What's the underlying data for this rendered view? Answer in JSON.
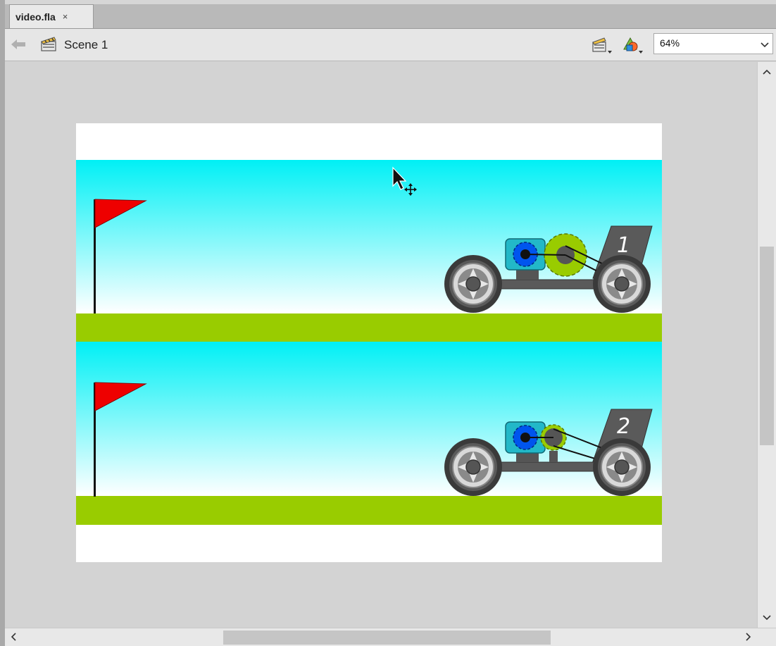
{
  "document": {
    "tab_title": "video.fla",
    "close_glyph": "×"
  },
  "editbar": {
    "scene_label": "Scene 1",
    "zoom_value": "64%",
    "icons": [
      "back-arrow-icon",
      "scene-clapper-icon",
      "edit-symbols-icon",
      "edit-objects-icon",
      "chevron-down-icon"
    ]
  },
  "stage": {
    "cars": [
      {
        "number": "1"
      },
      {
        "number": "2"
      }
    ]
  },
  "colors": {
    "sky_top": "#00f0f5",
    "sky_bottom": "#ffffff",
    "grass": "#99cc00",
    "flag": "#ee0000",
    "gear_large_lime": "#99cc00",
    "gear_blue": "#0055ee",
    "motor_teal": "#22b8c8",
    "chassis": "#555555"
  }
}
